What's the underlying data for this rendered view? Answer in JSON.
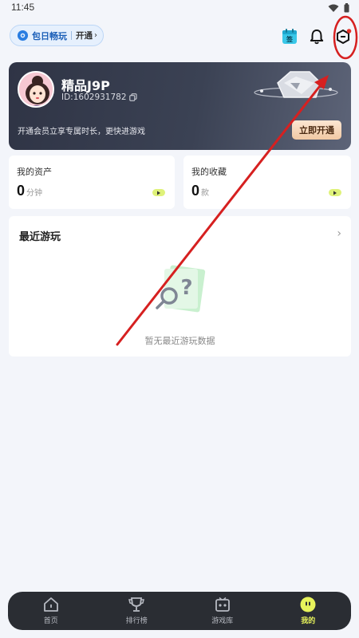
{
  "status": {
    "time": "11:45"
  },
  "promo": {
    "text": "包日畅玩",
    "action": "开通"
  },
  "header_icons": [
    "sign-in-icon",
    "bell-icon",
    "settings-icon"
  ],
  "member": {
    "username": "精品J9P",
    "user_id": "ID:1602931782",
    "description": "开通会员立享专属时长，更快进游戏",
    "open_button": "立即开通"
  },
  "assets": {
    "title": "我的资产",
    "value": "0",
    "unit": "分钟"
  },
  "favorites": {
    "title": "我的收藏",
    "value": "0",
    "unit": "款"
  },
  "recent": {
    "title": "最近游玩",
    "empty_text": "暂无最近游玩数据"
  },
  "nav": {
    "items": [
      {
        "label": "首页",
        "icon": "home-icon"
      },
      {
        "label": "排行榜",
        "icon": "trophy-icon"
      },
      {
        "label": "游戏库",
        "icon": "game-library-icon"
      },
      {
        "label": "我的",
        "icon": "profile-icon"
      }
    ],
    "active_index": 3
  },
  "colors": {
    "accent": "#e7f35b",
    "annotation": "#d62020",
    "card_dark": "#3b4254"
  }
}
